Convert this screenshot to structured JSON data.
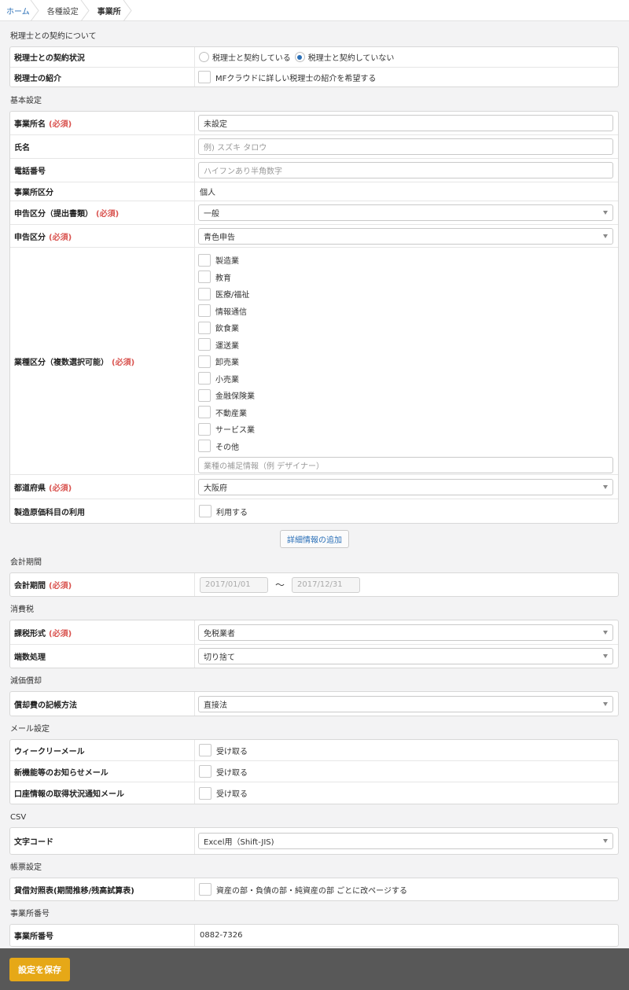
{
  "breadcrumb": {
    "home": "ホーム",
    "settings": "各種設定",
    "current": "事業所"
  },
  "required_label": "(必須)",
  "contract": {
    "title": "税理士との契約について",
    "status_label": "税理士との契約状況",
    "option_yes": "税理士と契約している",
    "option_no": "税理士と契約していない",
    "selected": "no",
    "intro_label": "税理士の紹介",
    "intro_checkbox": "MFクラウドに詳しい税理士の紹介を希望する"
  },
  "basic": {
    "title": "基本設定",
    "office_name_label": "事業所名",
    "office_name_value": "未設定",
    "name_label": "氏名",
    "name_placeholder": "例) スズキ タロウ",
    "phone_label": "電話番号",
    "phone_placeholder": "ハイフンあり半角数字",
    "office_type_label": "事業所区分",
    "office_type_value": "個人",
    "filing_doc_label": "申告区分（提出書類）",
    "filing_doc_value": "一般",
    "filing_type_label": "申告区分",
    "filing_type_value": "青色申告",
    "industry_label": "業種区分（複数選択可能）",
    "industries": [
      "製造業",
      "教育",
      "医療/福祉",
      "情報通信",
      "飲食業",
      "運送業",
      "卸売業",
      "小売業",
      "金融保険業",
      "不動産業",
      "サービス業",
      "その他"
    ],
    "industry_note_placeholder": "業種の補足情報（例 デザイナー）",
    "prefecture_label": "都道府県",
    "prefecture_value": "大阪府",
    "mfg_cost_label": "製造原価科目の利用",
    "mfg_cost_checkbox": "利用する"
  },
  "detail_button": "詳細情報の追加",
  "period": {
    "title": "会計期間",
    "label": "会計期間",
    "start": "2017/01/01",
    "separator": "〜",
    "end": "2017/12/31"
  },
  "tax": {
    "title": "消費税",
    "method_label": "課税形式",
    "method_value": "免税業者",
    "rounding_label": "端数処理",
    "rounding_value": "切り捨て"
  },
  "depreciation": {
    "title": "減価償却",
    "label": "償却費の記帳方法",
    "value": "直接法"
  },
  "mail": {
    "title": "メール設定",
    "weekly_label": "ウィークリーメール",
    "news_label": "新機能等のお知らせメール",
    "account_label": "口座情報の取得状況通知メール",
    "checkbox_text": "受け取る"
  },
  "csv": {
    "title": "CSV",
    "label": "文字コード",
    "value": "Excel用（Shift-JIS)"
  },
  "ledger": {
    "title": "帳票設定",
    "label": "貸借対照表(期間推移/残高試算表)",
    "checkbox_text": "資産の部・負債の部・純資産の部 ごとに改ページする"
  },
  "office_number": {
    "title": "事業所番号",
    "label": "事業所番号",
    "value": "0882-7326"
  },
  "save_button": "設定を保存"
}
